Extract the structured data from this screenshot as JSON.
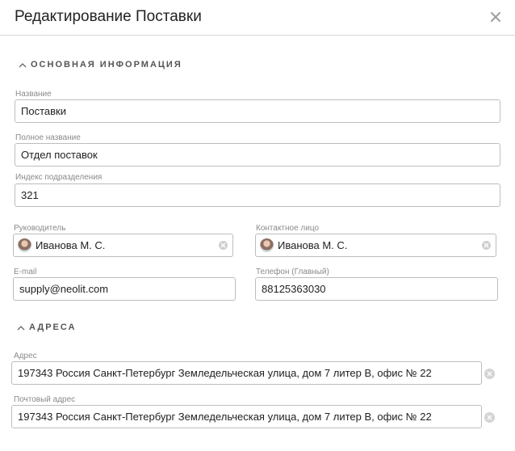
{
  "dialog": {
    "title": "Редактирование Поставки",
    "close_icon": "close-icon"
  },
  "sections": {
    "main_info": "ОСНОВНАЯ ИНФОРМАЦИЯ",
    "addresses": "АДРЕСА"
  },
  "fields": {
    "name": {
      "label": "Название",
      "value": "Поставки"
    },
    "full_name": {
      "label": "Полное название",
      "value": "Отдел поставок"
    },
    "division_index": {
      "label": "Индекс подразделения",
      "value": "321"
    },
    "manager": {
      "label": "Руководитель",
      "value": "Иванова М. С.",
      "avatar_icon": "user-avatar"
    },
    "contact": {
      "label": "Контактное лицо",
      "value": "Иванова М. С.",
      "avatar_icon": "user-avatar"
    },
    "email": {
      "label": "E-mail",
      "value": "supply@neolit.com"
    },
    "phone": {
      "label": "Телефон (Главный)",
      "value": "88125363030"
    },
    "address": {
      "label": "Адрес",
      "value": "197343 Россия Санкт-Петербург Земледельческая улица, дом 7 литер В, офис № 22"
    },
    "postal_address": {
      "label": "Почтовый адрес",
      "value": "197343 Россия Санкт-Петербург Земледельческая улица, дом 7 литер В, офис № 22"
    }
  }
}
